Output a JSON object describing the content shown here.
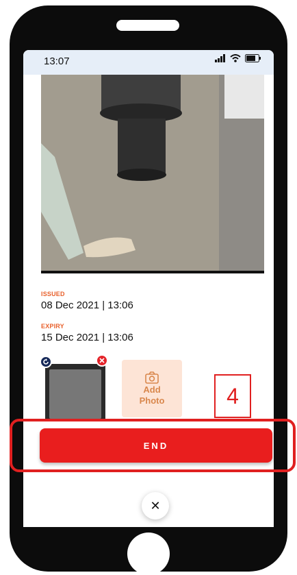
{
  "status_bar": {
    "time": "13:07",
    "icons": [
      "signal-icon",
      "wifi-icon",
      "battery-icon"
    ]
  },
  "ticket": {
    "issued_label": "ISSUED",
    "issued_value": "08 Dec 2021 | 13:06",
    "expiry_label": "EXPIRY",
    "expiry_value": "15 Dec 2021 | 13:06"
  },
  "photos": {
    "add_photo_label_line1": "Add",
    "add_photo_label_line2": "Photo"
  },
  "actions": {
    "end_label": "END",
    "close_symbol": "✕"
  },
  "annotation": {
    "step_number": "4"
  },
  "colors": {
    "accent_orange": "#e8612c",
    "end_button_red": "#e91e1e",
    "add_photo_bg": "#fde4d6",
    "annotation_red": "#e02020"
  }
}
